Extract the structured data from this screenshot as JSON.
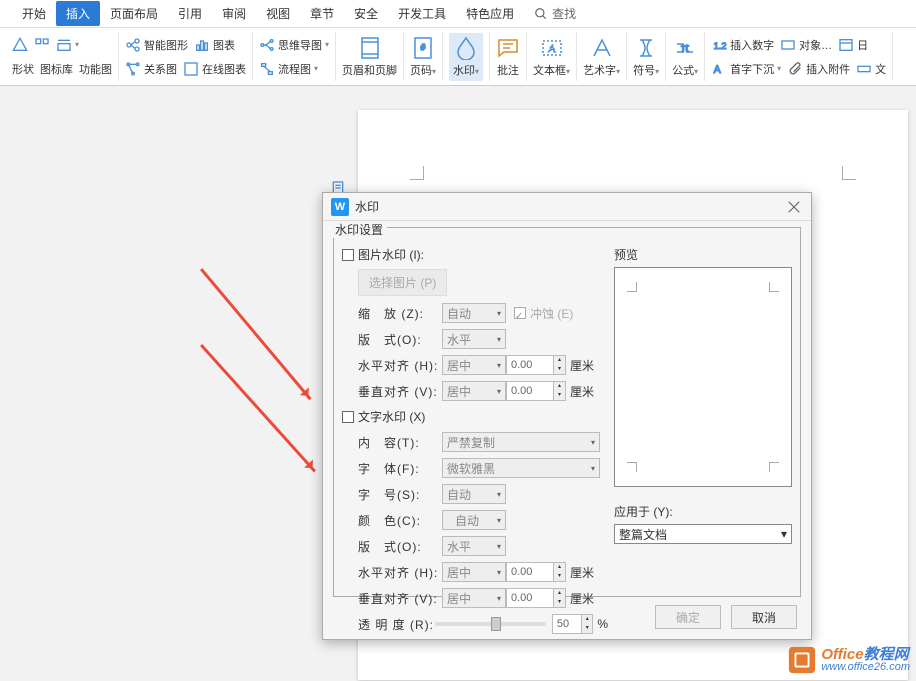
{
  "tabs": [
    "开始",
    "插入",
    "页面布局",
    "引用",
    "审阅",
    "视图",
    "章节",
    "安全",
    "开发工具",
    "特色应用"
  ],
  "active_tab_index": 1,
  "search_label": "查找",
  "ribbon": {
    "row1": [
      "智能图形",
      "图表",
      "思维导图"
    ],
    "row2": [
      "关系图",
      "在线图表",
      "流程图"
    ],
    "left": [
      "形状",
      "图标库",
      "功能图"
    ],
    "mid": [
      "页眉和页脚",
      "页码",
      "水印",
      "批注"
    ],
    "right": [
      "文本框",
      "艺术字",
      "符号",
      "公式"
    ],
    "far": [
      "插入数字",
      "对象…",
      "日",
      "首字下沉",
      "插入附件",
      "文"
    ]
  },
  "dialog": {
    "title": "水印",
    "section": "水印设置",
    "pic_watermark": "图片水印 (I):",
    "select_pic": "选择图片 (P)",
    "zoom": "缩　放 (Z):",
    "zoom_val": "自动",
    "erode": "冲蚀 (E)",
    "layout1": "版　式(O):",
    "layout1_val": "水平",
    "halign1": "水平对齐 (H):",
    "halign1_val": "居中",
    "halign1_num": "0.00",
    "valign1": "垂直对齐 (V):",
    "valign1_val": "居中",
    "valign1_num": "0.00",
    "unit_cm": "厘米",
    "text_watermark": "文字水印 (X)",
    "content": "内　容(T):",
    "content_val": "严禁复制",
    "font": "字　体(F):",
    "font_val": "微软雅黑",
    "fontsize": "字　号(S):",
    "fontsize_val": "自动",
    "color": "颜　色(C):",
    "color_val": "自动",
    "layout2": "版　式(O):",
    "layout2_val": "水平",
    "halign2": "水平对齐 (H):",
    "halign2_val": "居中",
    "halign2_num": "0.00",
    "valign2": "垂直对齐 (V):",
    "valign2_val": "居中",
    "valign2_num": "0.00",
    "opacity": "透 明 度 (R):",
    "opacity_val": "50",
    "percent": "%",
    "preview": "预览",
    "apply_to": "应用于 (Y):",
    "apply_val": "整篇文档",
    "ok": "确定",
    "cancel": "取消"
  },
  "logo": {
    "t1a": "Office",
    "t1b": "教程网",
    "t2": "www.office26.com"
  }
}
